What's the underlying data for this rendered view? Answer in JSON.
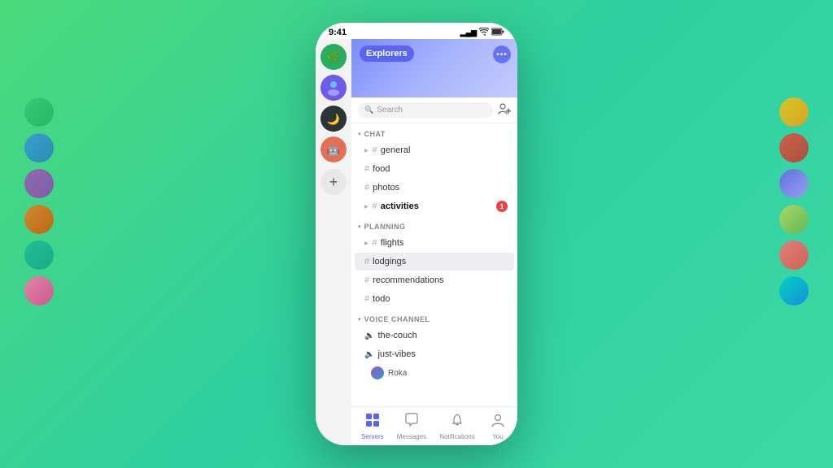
{
  "status_bar": {
    "time": "9:41",
    "signal": "▂▄▆",
    "wifi": "WiFi",
    "battery": "🔋"
  },
  "server": {
    "name": "Explorers",
    "options_label": "•••"
  },
  "search": {
    "placeholder": "Search",
    "add_member_icon": "person+"
  },
  "categories": {
    "chat": {
      "label": "CHAT",
      "channels": [
        {
          "name": "general",
          "has_expand": true,
          "has_notification": false
        },
        {
          "name": "food",
          "has_expand": false,
          "has_notification": false
        },
        {
          "name": "photos",
          "has_expand": false,
          "has_notification": false
        },
        {
          "name": "activities",
          "has_expand": true,
          "has_notification": true,
          "badge": "1"
        }
      ]
    },
    "planning": {
      "label": "PLANNING",
      "channels": [
        {
          "name": "flights",
          "has_expand": true,
          "has_notification": false
        },
        {
          "name": "lodgings",
          "has_expand": false,
          "has_notification": false,
          "active": true
        },
        {
          "name": "recommendations",
          "has_expand": false,
          "has_notification": false
        },
        {
          "name": "todo",
          "has_expand": false,
          "has_notification": false
        }
      ]
    },
    "voice": {
      "label": "VOICE CHANNEL",
      "channels": [
        {
          "name": "the-couch"
        },
        {
          "name": "just-vibes"
        }
      ],
      "members": [
        {
          "name": "Roka"
        }
      ]
    }
  },
  "bottom_nav": {
    "items": [
      {
        "label": "Servers",
        "icon": "grid",
        "active": true
      },
      {
        "label": "Messages",
        "icon": "chat",
        "active": false
      },
      {
        "label": "Notifications",
        "icon": "bell",
        "active": false
      },
      {
        "label": "You",
        "icon": "person",
        "active": false
      }
    ]
  },
  "deco_circles": {
    "left": [
      "avatar-green",
      "avatar-blue",
      "avatar-purple",
      "avatar-orange",
      "avatar-teal",
      "avatar-pink"
    ],
    "right": [
      "avatar-yellow",
      "avatar-red",
      "avatar-indigo",
      "avatar-lime",
      "avatar-coral",
      "avatar-cyan"
    ]
  }
}
